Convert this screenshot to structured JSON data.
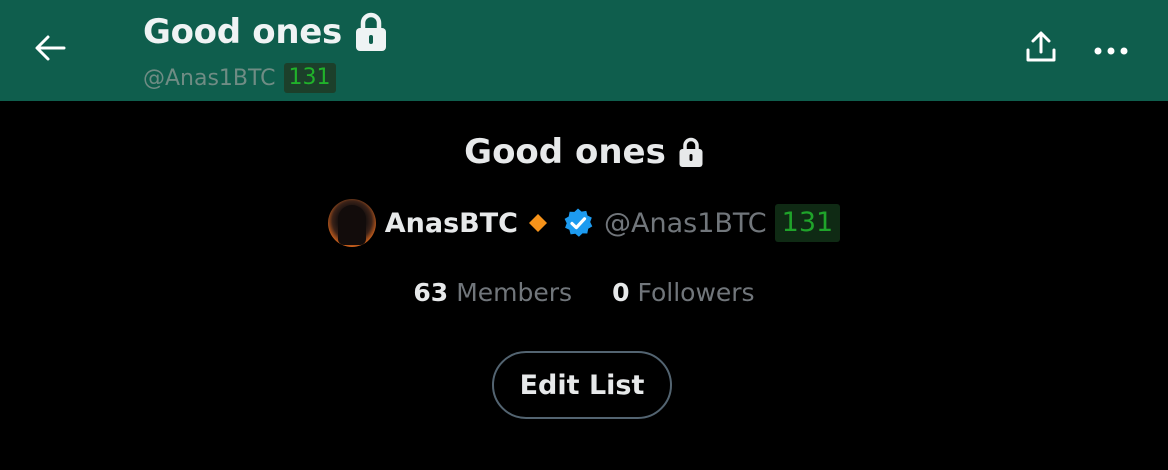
{
  "header": {
    "title": "Good ones",
    "handle": "@Anas1BTC",
    "badge": "131",
    "background_color": "#0f5e4d",
    "back_icon": "arrow-left-icon",
    "share_icon": "share-upload-icon",
    "more_icon": "more-horizontal-icon",
    "lock_icon": "lock-icon"
  },
  "list": {
    "title": "Good ones",
    "lock_icon": "lock-icon"
  },
  "owner": {
    "name": "AnasBTC",
    "handle": "@Anas1BTC",
    "badge": "131",
    "badge_color": "#1fa32a",
    "avatar_icon": "avatar",
    "diamond_icon": "orange-diamond-icon",
    "diamond_color": "#f7931a",
    "verified_icon": "verified-badge-icon",
    "verified_color": "#1d9bf0"
  },
  "stats": {
    "members_count": "63",
    "members_label": "Members",
    "followers_count": "0",
    "followers_label": "Followers"
  },
  "actions": {
    "edit_label": "Edit List"
  }
}
